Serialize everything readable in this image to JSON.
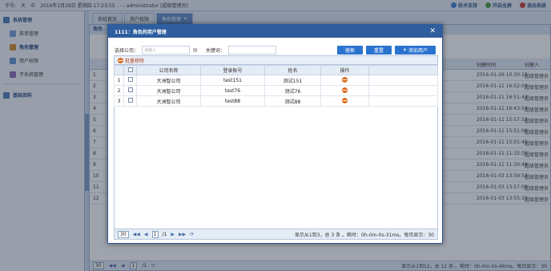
{
  "topbar": {
    "font_size_label": "字号:",
    "size_large": "大",
    "size_medium": "中",
    "datetime": "2016年1月28日 星期四 17:23:55",
    "user": "- - administrator [超级管理员]",
    "tech_support": "技术支持",
    "fullscreen": "开启全屏",
    "logout": "退出系统"
  },
  "sidebar": {
    "system_heading": "系统管理",
    "items": [
      {
        "label": "菜单管理"
      },
      {
        "label": "角色管理"
      },
      {
        "label": "用户权限"
      },
      {
        "label": "子系统管理"
      }
    ],
    "base_heading": "基础资料"
  },
  "tabs": [
    {
      "label": "系统首页"
    },
    {
      "label": "用户权限"
    },
    {
      "label": "角色管理"
    }
  ],
  "main": {
    "title": "角色",
    "header_time": "创建时间",
    "header_creator": "创建人",
    "rows": [
      {
        "no": "1",
        "time": "2016-01-26 10:30:15",
        "creator": "超级管理员"
      },
      {
        "no": "2",
        "time": "2016-01-11 16:52:04",
        "creator": "超级管理员"
      },
      {
        "no": "3",
        "time": "2016-01-11 16:51:43",
        "creator": "超级管理员"
      },
      {
        "no": "4",
        "time": "2016-01-11 16:43:54",
        "creator": "超级管理员"
      },
      {
        "no": "5",
        "time": "2016-01-11 15:57:53",
        "creator": "超级管理员"
      },
      {
        "no": "6",
        "time": "2016-01-11 15:51:06",
        "creator": "超级管理员"
      },
      {
        "no": "7",
        "time": "2016-01-11 15:01:45",
        "creator": "超级管理员"
      },
      {
        "no": "8",
        "time": "2016-01-11 11:32:35",
        "creator": "超级管理员"
      },
      {
        "no": "9",
        "time": "2016-01-11 11:30:49",
        "creator": "超级管理员"
      },
      {
        "no": "10",
        "time": "2016-01-03 13:59:53",
        "creator": "超级管理员"
      },
      {
        "no": "11",
        "time": "2016-01-03 13:57:00",
        "creator": "超级管理员"
      },
      {
        "no": "12",
        "time": "2016-01-03 13:55:15",
        "creator": "超级管理员"
      }
    ],
    "pager": {
      "size": "30",
      "page": "1",
      "total_pages": "/1",
      "info": "显示从1到12，总 12 条 。耗时：0h-0m-0s-46ms。每页显示：30"
    }
  },
  "modal": {
    "title": "1111：角色的用户管理",
    "close_glyph": "✕",
    "filter": {
      "company_label": "选择公司：",
      "company_placeholder": "请输入",
      "keyword_label": "关键词：",
      "search_btn": "搜索",
      "reset_btn": "重置",
      "add_btn": "添加用户"
    },
    "batch_remove": "批量移除",
    "columns": [
      "",
      "",
      "公司名称",
      "登录账号",
      "姓名",
      "操作"
    ],
    "rows": [
      {
        "no": "1",
        "company": "大洲智公司",
        "account": "test151",
        "name": "测试151"
      },
      {
        "no": "2",
        "company": "大洲智公司",
        "account": "test76",
        "name": "测试76"
      },
      {
        "no": "3",
        "company": "大洲智公司",
        "account": "test88",
        "name": "测试88"
      }
    ],
    "pager": {
      "size": "30",
      "page": "1",
      "total_pages": "/1",
      "info": "显示从1到3，总 3 条 。耗时：0h-0m-0s-31ms。每页显示：30"
    }
  },
  "colors": {
    "header_blue": "#2e5e9e",
    "button_blue": "#2a74cf",
    "delete_orange": "#e06a1a"
  }
}
